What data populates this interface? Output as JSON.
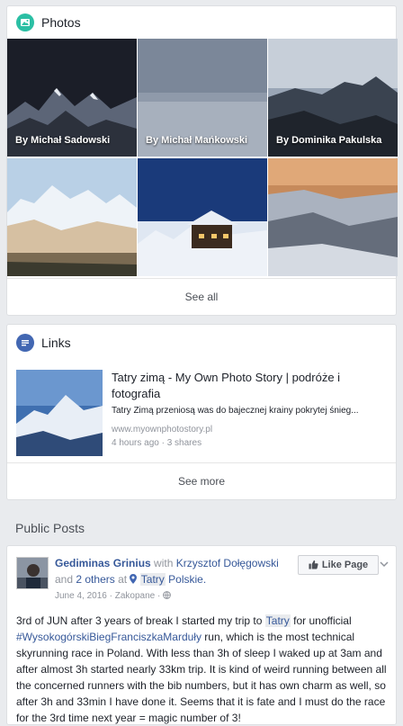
{
  "photos": {
    "title": "Photos",
    "icon": "photos-icon",
    "tiles": [
      {
        "caption": "By Michał Sadowski"
      },
      {
        "caption": "By Michał Mańkowski"
      },
      {
        "caption": "By Dominika Pakulska"
      },
      {
        "caption": ""
      },
      {
        "caption": ""
      },
      {
        "caption": ""
      }
    ],
    "see_all": "See all"
  },
  "links": {
    "title": "Links",
    "icon": "links-icon",
    "item": {
      "title": "Tatry zimą - My Own Photo Story | podróże i fotografia",
      "description": "Tatry Zimą przeniosą was do bajecznej krainy pokrytej śnieg...",
      "domain": "www.myownphotostory.pl",
      "time": "4 hours ago",
      "shares": "3 shares"
    },
    "see_more": "See more"
  },
  "public_posts": {
    "title": "Public Posts",
    "post": {
      "author": "Gediminas Grinius",
      "with_word": "with",
      "with_person": "Krzysztof Dołęgowski",
      "and_word": "and",
      "others": "2 others",
      "at_word": "at",
      "place_tag": "Tatry",
      "place_rest": "Polskie.",
      "date": "June 4, 2016",
      "location": "Zakopane",
      "like_button": "Like Page",
      "text_before_tag": "3rd of JUN after 3 years of break I started my trip to ",
      "text_tag1": "Tatry",
      "text_mid": " for unofficial ",
      "text_tag2": "#WysokogórskiBiegFranciszkaMarduły",
      "text_after": " run, which is the most technical skyrunning race in Poland. With less than 3h of sleep I waked up at 3am and after almost 3h started nearly 33km trip. It is kind of weird running between all the concerned runners with the bib numbers, but it has own charm as well, so after 3h and 33min I have done it. Seems that it is fate and I must do the race for the 3rd time next year = magic number of 3!"
    }
  },
  "colors": {
    "photos_icon_bg": "#2bbfa4",
    "links_icon_bg": "#4267b2",
    "link_blue": "#365899"
  }
}
